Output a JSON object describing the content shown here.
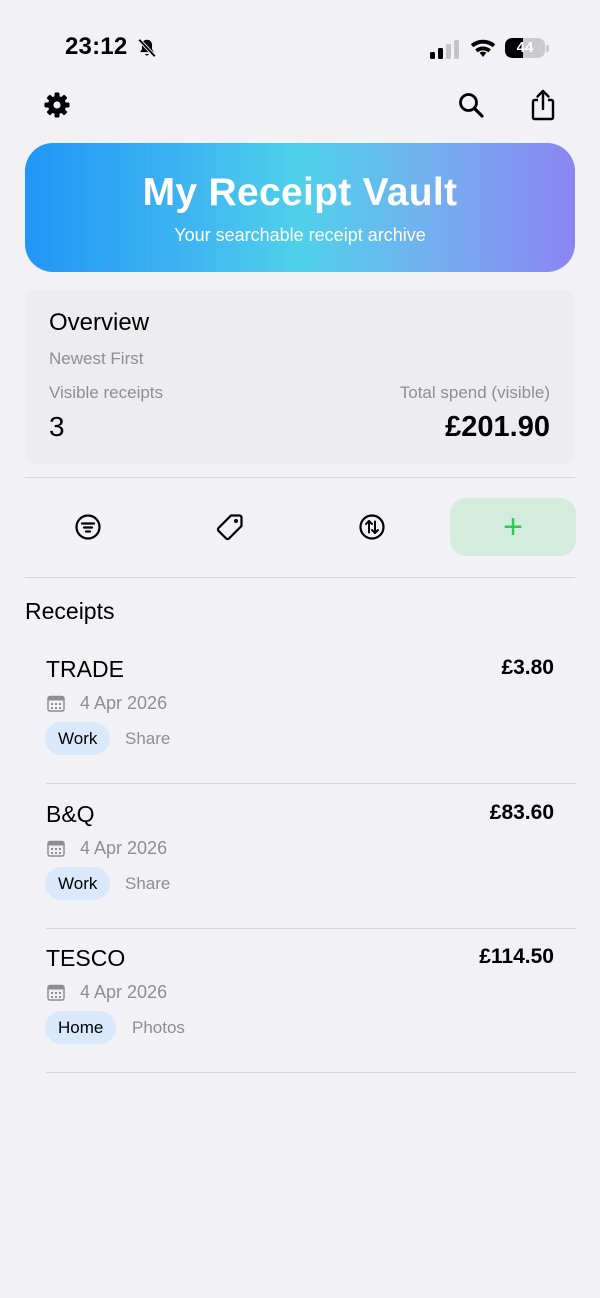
{
  "status_bar": {
    "time": "23:12",
    "battery_level": "44",
    "battery_fraction": 0.44,
    "icons": [
      "bell-slash-icon",
      "cellular-signal-icon",
      "wifi-icon",
      "battery-icon"
    ]
  },
  "toolbar": {
    "settings_icon": "gear-icon",
    "search_icon": "magnifier-icon",
    "share_icon": "share-icon"
  },
  "banner": {
    "title": "My Receipt Vault",
    "subtitle": "Your searchable receipt archive",
    "gradient_colors": [
      "#2196f7",
      "#4fd1ea",
      "#8b85f3"
    ]
  },
  "overview": {
    "title": "Overview",
    "sort_label": "Newest First",
    "visible_label": "Visible receipts",
    "visible_count": "3",
    "spend_label": "Total spend (visible)",
    "spend_value": "£201.90"
  },
  "actions": {
    "filter_icon": "filter-icon",
    "tag_icon": "tag-icon",
    "sort_icon": "sort-arrows-icon",
    "add_icon": "plus-icon",
    "add_symbol": "+",
    "add_color": "#34c759"
  },
  "receipts_section": {
    "title": "Receipts",
    "items": [
      {
        "merchant": "TRADE",
        "amount": "£3.80",
        "date": "4 Apr 2026",
        "tag": "Work",
        "extra": "Share"
      },
      {
        "merchant": "B&Q",
        "amount": "£83.60",
        "date": "4 Apr 2026",
        "tag": "Work",
        "extra": "Share"
      },
      {
        "merchant": "TESCO",
        "amount": "£114.50",
        "date": "4 Apr 2026",
        "tag": "Home",
        "extra": "Photos"
      }
    ]
  }
}
